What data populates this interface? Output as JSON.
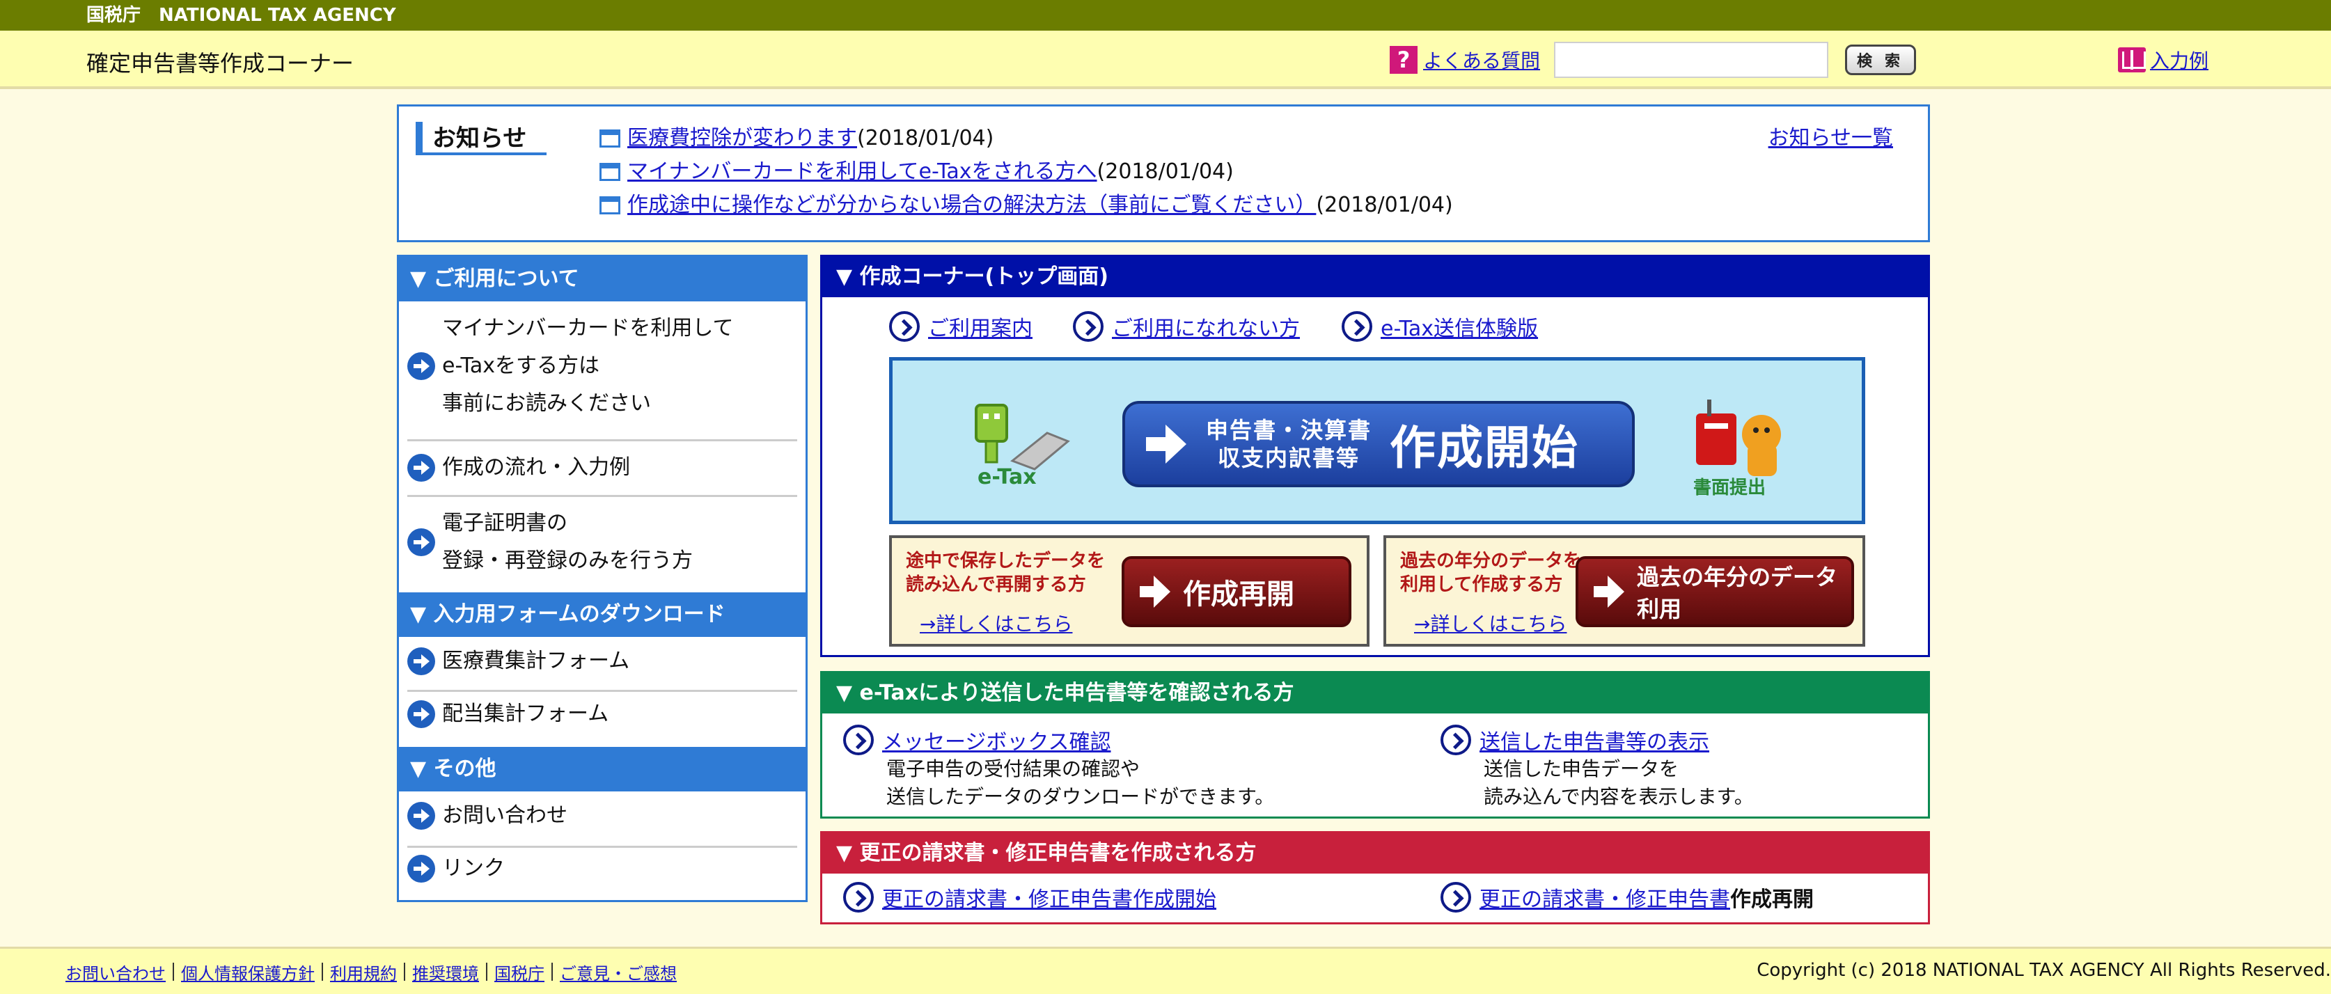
{
  "agency": {
    "ja": "国税庁",
    "en": "NATIONAL TAX AGENCY"
  },
  "header": {
    "site_title": "確定申告書等作成コーナー",
    "faq_label": "よくある質問",
    "search_placeholder": "",
    "search_button": "検 索",
    "example_label": "入力例"
  },
  "notices": {
    "title": "お知らせ",
    "all_link": "お知らせ一覧",
    "items": [
      {
        "link": "医療費控除が変わります",
        "date": "(2018/01/04)"
      },
      {
        "link": "マイナンバーカードを利用してe-Taxをされる方へ",
        "date": "(2018/01/04)"
      },
      {
        "link": "作成途中に操作などが分からない場合の解決方法（事前にご覧ください）",
        "date": "(2018/01/04)"
      }
    ]
  },
  "sidebar": {
    "sections": [
      {
        "title": "▼ ご利用について"
      },
      {
        "title": "▼ 入力用フォームのダウンロード"
      },
      {
        "title": "▼ その他"
      }
    ],
    "items": [
      {
        "line1": "マイナンバーカードを利用して",
        "line2": "e-Taxをする方は",
        "line3": "事前にお読みください"
      },
      {
        "line1": "作成の流れ・入力例"
      },
      {
        "line1": "電子証明書の",
        "line2": "登録・再登録のみを行う方"
      },
      {
        "line1": "医療費集計フォーム"
      },
      {
        "line1": "配当集計フォーム"
      },
      {
        "line1": "お問い合わせ"
      },
      {
        "line1": "リンク"
      }
    ]
  },
  "top_panel": {
    "title": "▼ 作成コーナー(トップ画面)",
    "links": [
      "ご利用案内",
      "ご利用になれない方",
      "e-Tax送信体験版"
    ],
    "banner": {
      "etax_label": "e-Tax",
      "start_sub_line1": "申告書・決算書",
      "start_sub_line2": "収支内訳書等",
      "start_main": "作成開始",
      "paper_label": "書面提出"
    },
    "resume": {
      "note_line1": "途中で保存したデータを",
      "note_line2": "読み込んで再開する方",
      "button": "作成再開",
      "detail_link": "→詳しくはこちら"
    },
    "past": {
      "note_line1": "過去の年分のデータを",
      "note_line2": "利用して作成する方",
      "button": "過去の年分のデータ利用",
      "detail_link": "→詳しくはこちら"
    }
  },
  "etax_panel": {
    "title": "▼ e-Taxにより送信した申告書等を確認される方",
    "left_link": "メッセージボックス確認",
    "left_desc1": "電子申告の受付結果の確認や",
    "left_desc2": "送信したデータのダウンロードができます。",
    "right_link": "送信した申告書等の表示",
    "right_desc1": "送信した申告データを",
    "right_desc2": "読み込んで内容を表示します。"
  },
  "correct_panel": {
    "title": "▼ 更正の請求書・修正申告書を作成される方",
    "left_link": "更正の請求書・修正申告書作成開始",
    "right_link": "更正の請求書・修正申告書",
    "right_suffix": "作成再開"
  },
  "footer": {
    "links": [
      "お問い合わせ",
      "個人情報保護方針",
      "利用規約",
      "推奨環境",
      "国税庁",
      "ご意見・ご感想"
    ],
    "copyright": "Copyright (c) 2018 NATIONAL TAX AGENCY All Rights Reserved."
  },
  "colors": {
    "agency_bar": "#6b7d00",
    "header_bg": "#fefeb1",
    "page_bg": "#fefbe2",
    "sidebar_blue": "#2f7bd5",
    "top_panel_navy": "#0010a8",
    "etax_green": "#0b8a52",
    "correct_red": "#c8203c",
    "link": "#1a1acc"
  }
}
